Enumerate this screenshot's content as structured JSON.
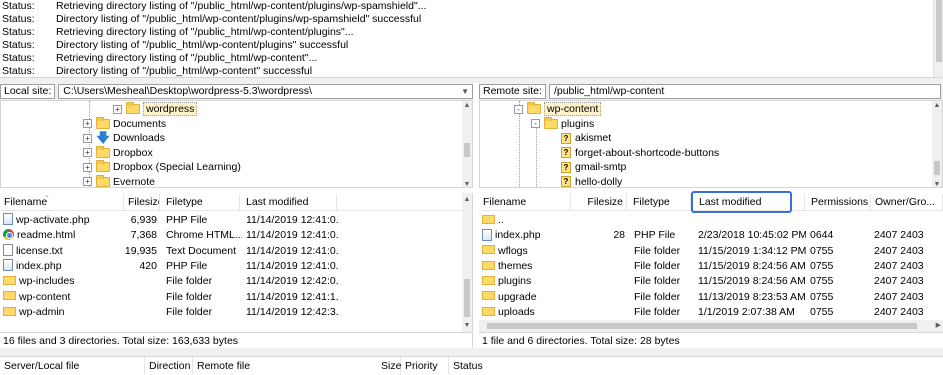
{
  "message_log": [
    {
      "label": "Status:",
      "text": "Retrieving directory listing of \"/public_html/wp-content/plugins/wp-spamshield\"..."
    },
    {
      "label": "Status:",
      "text": "Directory listing of \"/public_html/wp-content/plugins/wp-spamshield\" successful"
    },
    {
      "label": "Status:",
      "text": "Retrieving directory listing of \"/public_html/wp-content/plugins\"..."
    },
    {
      "label": "Status:",
      "text": "Directory listing of \"/public_html/wp-content/plugins\" successful"
    },
    {
      "label": "Status:",
      "text": "Retrieving directory listing of \"/public_html/wp-content\"..."
    },
    {
      "label": "Status:",
      "text": "Directory listing of \"/public_html/wp-content\" successful"
    }
  ],
  "local": {
    "site_label": "Local site:",
    "path": "C:\\Users\\Mesheal\\Desktop\\wordpress-5.3\\wordpress\\",
    "tree": [
      {
        "label": "wordpress",
        "icon": "folder-icon",
        "expander": "+",
        "selected": true
      },
      {
        "label": "Documents",
        "icon": "folder-icon",
        "expander": "+"
      },
      {
        "label": "Downloads",
        "icon": "download-arrow-icon",
        "expander": "+"
      },
      {
        "label": "Dropbox",
        "icon": "folder-icon",
        "expander": "+"
      },
      {
        "label": "Dropbox (Special Learning)",
        "icon": "folder-icon",
        "expander": "+"
      },
      {
        "label": "Evernote",
        "icon": "folder-icon",
        "expander": "+"
      }
    ],
    "columns": [
      "Filename",
      "Filesize",
      "Filetype",
      "Last modified"
    ],
    "files": [
      {
        "name": "wp-activate.php",
        "size": "6,939",
        "type": "PHP File",
        "modified": "11/14/2019 12:41:0...",
        "icon": "php-file-icon"
      },
      {
        "name": "readme.html",
        "size": "7,368",
        "type": "Chrome HTML...",
        "modified": "11/14/2019 12:41:0...",
        "icon": "chrome-html-icon"
      },
      {
        "name": "license.txt",
        "size": "19,935",
        "type": "Text Document",
        "modified": "11/14/2019 12:41:0...",
        "icon": "text-file-icon"
      },
      {
        "name": "index.php",
        "size": "420",
        "type": "PHP File",
        "modified": "11/14/2019 12:41:0...",
        "icon": "php-file-icon"
      },
      {
        "name": "wp-includes",
        "size": "",
        "type": "File folder",
        "modified": "11/14/2019 12:42:0...",
        "icon": "folder-icon"
      },
      {
        "name": "wp-content",
        "size": "",
        "type": "File folder",
        "modified": "11/14/2019 12:41:1...",
        "icon": "folder-icon"
      },
      {
        "name": "wp-admin",
        "size": "",
        "type": "File folder",
        "modified": "11/14/2019 12:42:3...",
        "icon": "folder-icon"
      }
    ],
    "status": "16 files and 3 directories. Total size: 163,633 bytes"
  },
  "remote": {
    "site_label": "Remote site:",
    "path": "/public_html/wp-content",
    "tree": [
      {
        "label": "wp-content",
        "icon": "folder-icon",
        "expander": "-",
        "selected": true,
        "level": 0
      },
      {
        "label": "plugins",
        "icon": "folder-icon",
        "expander": "-",
        "level": 1
      },
      {
        "label": "akismet",
        "icon": "unknown-folder-icon",
        "level": 2
      },
      {
        "label": "forget-about-shortcode-buttons",
        "icon": "unknown-folder-icon",
        "level": 2
      },
      {
        "label": "gmail-smtp",
        "icon": "unknown-folder-icon",
        "level": 2
      },
      {
        "label": "hello-dolly",
        "icon": "unknown-folder-icon",
        "level": 2
      }
    ],
    "columns": [
      "Filename",
      "Filesize",
      "Filetype",
      "Last modified",
      "Permissions",
      "Owner/Gro..."
    ],
    "files": [
      {
        "name": "..",
        "size": "",
        "type": "",
        "modified": "",
        "perms": "",
        "owner": "",
        "icon": "folder-icon"
      },
      {
        "name": "index.php",
        "size": "28",
        "type": "PHP File",
        "modified": "2/23/2018 10:45:02 PM",
        "perms": "0644",
        "owner": "2407 2403",
        "icon": "php-file-icon"
      },
      {
        "name": "wflogs",
        "size": "",
        "type": "File folder",
        "modified": "11/15/2019 1:34:12 PM",
        "perms": "0755",
        "owner": "2407 2403",
        "icon": "folder-icon"
      },
      {
        "name": "themes",
        "size": "",
        "type": "File folder",
        "modified": "11/15/2019 8:24:56 AM",
        "perms": "0755",
        "owner": "2407 2403",
        "icon": "folder-icon"
      },
      {
        "name": "plugins",
        "size": "",
        "type": "File folder",
        "modified": "11/15/2019 8:24:56 AM",
        "perms": "0755",
        "owner": "2407 2403",
        "icon": "folder-icon"
      },
      {
        "name": "upgrade",
        "size": "",
        "type": "File folder",
        "modified": "11/13/2019 8:23:53 AM",
        "perms": "0755",
        "owner": "2407 2403",
        "icon": "folder-icon"
      },
      {
        "name": "uploads",
        "size": "",
        "type": "File folder",
        "modified": "1/1/2019 2:07:38 AM",
        "perms": "0755",
        "owner": "2407 2403",
        "icon": "folder-icon"
      }
    ],
    "status": "1 file and 6 directories. Total size: 28 bytes"
  },
  "queue": {
    "columns": [
      "Server/Local file",
      "Direction",
      "Remote file",
      "Size",
      "Priority",
      "Status"
    ]
  },
  "colors": {
    "highlight": "#3b6fd9",
    "folder": "#ffd966"
  }
}
